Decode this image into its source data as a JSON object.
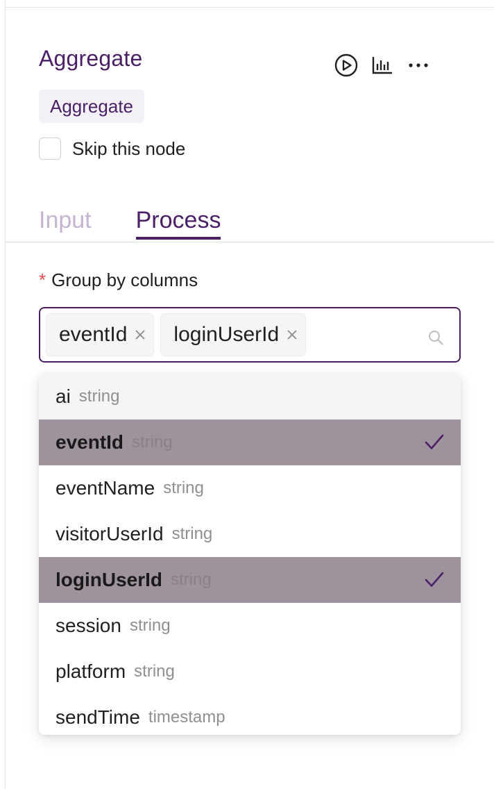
{
  "node": {
    "title": "Aggregate",
    "tag": "Aggregate",
    "skip_label": "Skip this node",
    "actions": [
      {
        "name": "run",
        "icon": "play-circle-icon"
      },
      {
        "name": "stats",
        "icon": "bar-chart-icon"
      },
      {
        "name": "more",
        "icon": "more-horizontal-icon"
      }
    ]
  },
  "tabs": [
    {
      "label": "Input",
      "active": false
    },
    {
      "label": "Process",
      "active": true
    }
  ],
  "group_by": {
    "required_mark": "*",
    "label": "Group by columns",
    "selected": [
      "eventId",
      "loginUserId"
    ],
    "search_icon": "search-icon"
  },
  "dropdown": {
    "options": [
      {
        "name": "ai",
        "type": "string",
        "state": "hover"
      },
      {
        "name": "eventId",
        "type": "string",
        "state": "selected"
      },
      {
        "name": "eventName",
        "type": "string",
        "state": "normal"
      },
      {
        "name": "visitorUserId",
        "type": "string",
        "state": "normal"
      },
      {
        "name": "loginUserId",
        "type": "string",
        "state": "selected"
      },
      {
        "name": "session",
        "type": "string",
        "state": "normal"
      },
      {
        "name": "platform",
        "type": "string",
        "state": "normal"
      },
      {
        "name": "sendTime",
        "type": "timestamp",
        "state": "normal"
      }
    ]
  },
  "colors": {
    "brand": "#4a1f66",
    "selected_row": "#9e929d",
    "required": "#e34d4d"
  }
}
